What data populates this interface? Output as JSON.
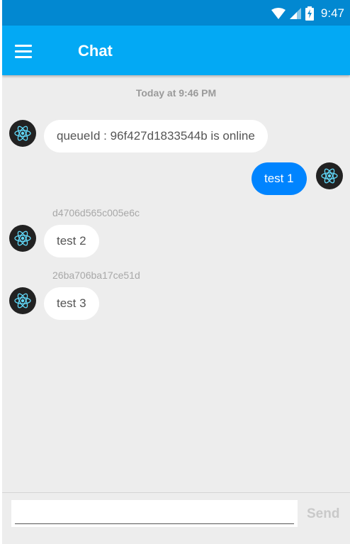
{
  "status_bar": {
    "time": "9:47",
    "icons": [
      "wifi-icon",
      "cell-signal-icon",
      "battery-charging-icon"
    ]
  },
  "app_bar": {
    "menu_icon": "hamburger-menu-icon",
    "title": "Chat"
  },
  "chat": {
    "day_label": "Today at 9:46 PM",
    "messages": [
      {
        "side": "left",
        "text": "queueId : 96f427d1833544b is online",
        "sender": ""
      },
      {
        "side": "right",
        "text": "test 1",
        "sender": ""
      },
      {
        "side": "left",
        "text": "test 2",
        "sender": "d4706d565c005e6c"
      },
      {
        "side": "left",
        "text": "test 3",
        "sender": "26ba706ba17ce51d"
      }
    ],
    "avatar_icon": "react-atom-icon"
  },
  "composer": {
    "input_value": "",
    "input_placeholder": "",
    "send_label": "Send"
  },
  "colors": {
    "status_bar": "#0288d1",
    "app_bar": "#03a9f4",
    "outgoing_bubble": "#0084ff",
    "incoming_bubble": "#ffffff",
    "background": "#ededed"
  }
}
